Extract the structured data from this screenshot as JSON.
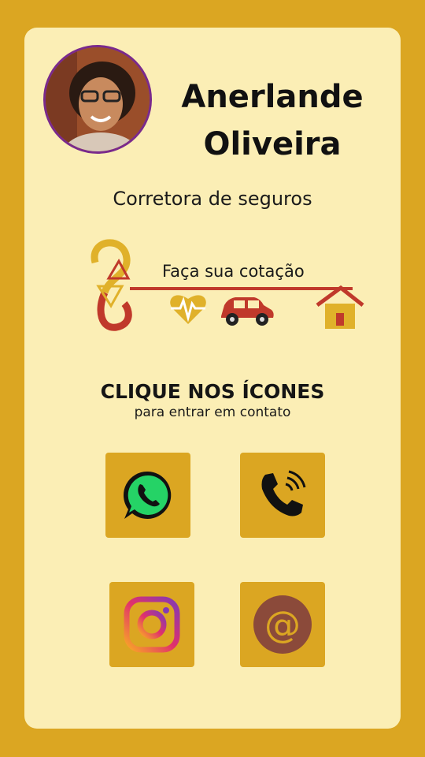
{
  "profile": {
    "first_name": "Anerlande",
    "last_name": "Oliveira",
    "role": "Corretora de seguros"
  },
  "banner": {
    "text": "Faça sua cotação",
    "icons": [
      "infinity-logo-icon",
      "heart-pulse-icon",
      "car-icon",
      "house-icon"
    ]
  },
  "cta": {
    "title": "CLIQUE NOS ÍCONES",
    "subtitle": "para entrar em contato"
  },
  "contacts": [
    {
      "icon": "whatsapp-icon"
    },
    {
      "icon": "phone-icon"
    },
    {
      "icon": "instagram-icon"
    },
    {
      "icon": "email-at-icon"
    }
  ],
  "colors": {
    "background": "#dba622",
    "card": "#fbeeb5",
    "button": "#dba622",
    "accent_red": "#c0392b",
    "avatar_border": "#7a2a8c"
  }
}
